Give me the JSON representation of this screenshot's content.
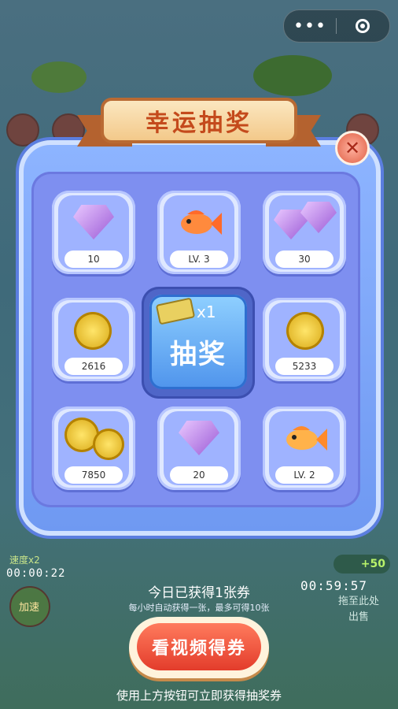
{
  "capsule": {
    "more": "•••"
  },
  "title": "幸运抽奖",
  "close_symbol": "✕",
  "prizes": [
    {
      "label": "10",
      "icon": "gem-icon"
    },
    {
      "label": "LV. 3",
      "icon": "fish-icon"
    },
    {
      "label": "30",
      "icon": "gems-icon"
    },
    {
      "label": "2616",
      "icon": "coin-icon"
    },
    {
      "label": "5233",
      "icon": "coin-icon"
    },
    {
      "label": "7850",
      "icon": "coins-icon"
    },
    {
      "label": "20",
      "icon": "gem-icon"
    },
    {
      "label": "LV. 2",
      "icon": "fish-icon"
    }
  ],
  "draw": {
    "ticket_count": "x1",
    "label": "抽奖"
  },
  "today_text": "今日已获得1张券",
  "sub_text": "每小时自动获得一张，最多可得10张",
  "video_button": "看视频得券",
  "hint": "使用上方按钮可立即获得抽奖券",
  "bg": {
    "left_timer": "00:00:22",
    "right_timer": "00:59:57",
    "speed_label": "速度x2",
    "accelerate": "加速",
    "gem_bonus": "+50",
    "drag_hint": "拖至此处出售"
  }
}
